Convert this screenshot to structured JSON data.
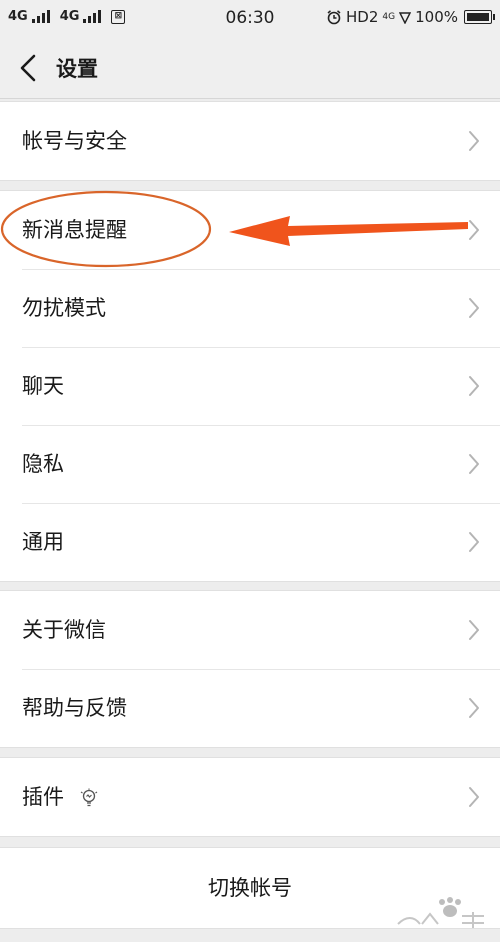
{
  "status_bar": {
    "net1": "4G",
    "net2": "4G",
    "sim_label": "SIM",
    "time": "06:30",
    "hd": "HD2",
    "hd_net": "4G",
    "battery": "100%"
  },
  "header": {
    "title": "设置"
  },
  "groups": [
    {
      "items": [
        {
          "label": "帐号与安全"
        }
      ]
    },
    {
      "items": [
        {
          "label": "新消息提醒"
        },
        {
          "label": "勿扰模式"
        },
        {
          "label": "聊天"
        },
        {
          "label": "隐私"
        },
        {
          "label": "通用"
        }
      ]
    },
    {
      "items": [
        {
          "label": "关于微信"
        },
        {
          "label": "帮助与反馈"
        }
      ]
    },
    {
      "items": [
        {
          "label": "插件"
        }
      ]
    }
  ],
  "switch_account": {
    "label": "切换帐号"
  },
  "annotation_color": "#e8500f",
  "icons": {
    "back": "chevron-left-icon",
    "row_arrow": "chevron-right-icon",
    "plugin": "lightbulb-icon"
  }
}
